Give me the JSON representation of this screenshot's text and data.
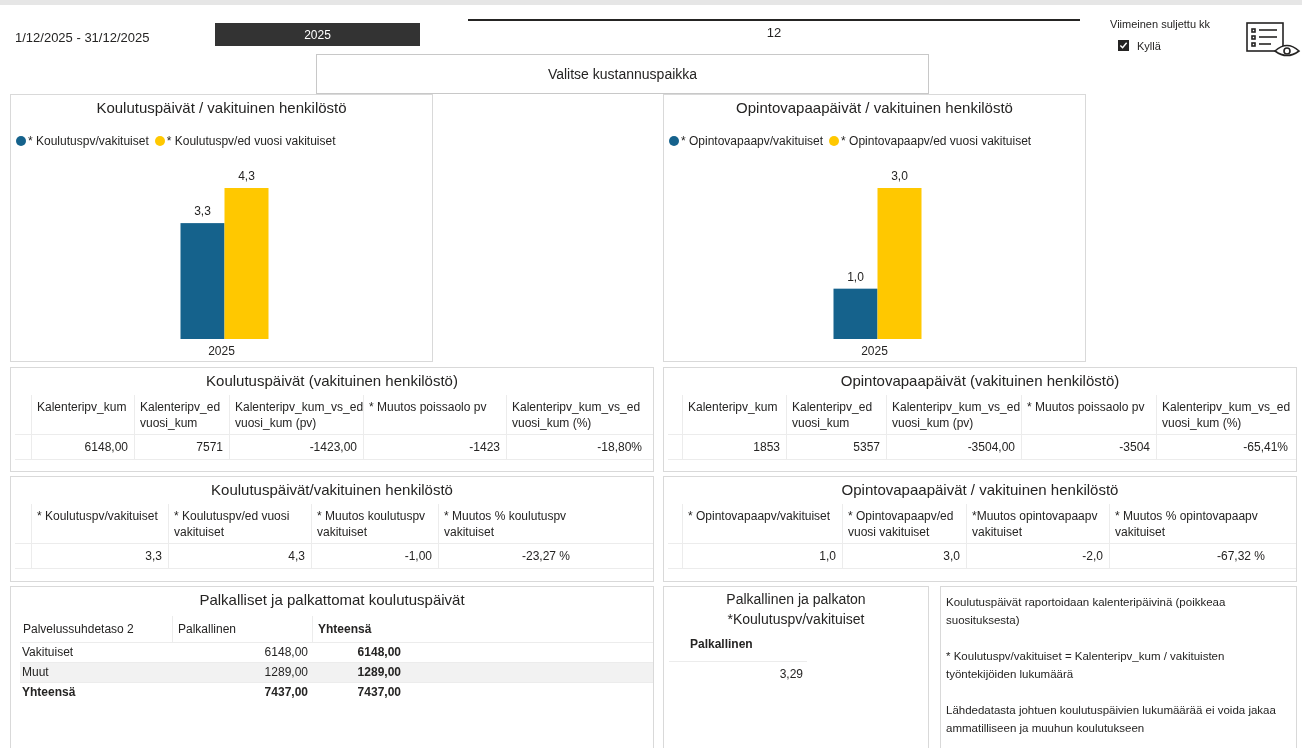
{
  "header": {
    "date_range": "1/12/2025 - 31/12/2025",
    "year_slicer": {
      "value": "2025"
    },
    "month_slicer": {
      "value": "12"
    },
    "closed_month_filter": {
      "title": "Viimeinen suljettu kk",
      "options": [
        {
          "label": "Kyllä",
          "checked": true
        }
      ]
    },
    "cost_center_button": {
      "label": "Valitse kustannuspaikka"
    }
  },
  "charts": [
    {
      "title": "Koulutuspäivät / vakituinen henkilöstö",
      "chart_data": {
        "type": "bar",
        "categories": [
          "2025"
        ],
        "series": [
          {
            "name": "* Koulutuspv/vakituiset",
            "color": "#15628c",
            "values": [
              3.3
            ],
            "value_labels": [
              "3,3"
            ]
          },
          {
            "name": "* Koulutuspv/ed vuosi vakituiset",
            "color": "#ffc800",
            "values": [
              4.3
            ],
            "value_labels": [
              "4,3"
            ]
          }
        ],
        "data_labels": true
      }
    },
    {
      "title": "Opintovapaapäivät / vakituinen henkilöstö",
      "chart_data": {
        "type": "bar",
        "categories": [
          "2025"
        ],
        "series": [
          {
            "name": "* Opintovapaapv/vakituiset",
            "color": "#15628c",
            "values": [
              1.0
            ],
            "value_labels": [
              "1,0"
            ]
          },
          {
            "name": "* Opintovapaapv/ed vuosi vakituiset",
            "color": "#ffc800",
            "values": [
              3.0
            ],
            "value_labels": [
              "3,0"
            ]
          }
        ],
        "data_labels": true
      }
    }
  ],
  "tables": [
    {
      "title": "Koulutuspäivät (vakituinen henkilöstö)",
      "columns": [
        "Kalenteripv_kum",
        "Kalenteripv_ed vuosi_kum",
        "Kalenteripv_kum_vs_ed vuosi_kum (pv)",
        "* Muutos poissaolo pv",
        "Kalenteripv_kum_vs_ed vuosi_kum (%)"
      ],
      "rows": [
        [
          "6148,00",
          "7571",
          "-1423,00",
          "-1423",
          "-18,80%"
        ]
      ]
    },
    {
      "title": "Opintovapaapäivät (vakituinen henkilöstö)",
      "columns": [
        "Kalenteripv_kum",
        "Kalenteripv_ed vuosi_kum",
        "Kalenteripv_kum_vs_ed vuosi_kum (pv)",
        "* Muutos poissaolo pv",
        "Kalenteripv_kum_vs_ed vuosi_kum (%)"
      ],
      "rows": [
        [
          "1853",
          "5357",
          "-3504,00",
          "-3504",
          "-65,41%"
        ]
      ]
    },
    {
      "title": "Koulutuspäivät/vakituinen henkilöstö",
      "columns": [
        "* Koulutuspv/vakituiset",
        "* Koulutuspv/ed vuosi vakituiset",
        "* Muutos koulutuspv vakituiset",
        "* Muutos % koulutuspv vakituiset"
      ],
      "rows": [
        [
          "3,3",
          "4,3",
          "-1,00",
          "-23,27 %"
        ]
      ]
    },
    {
      "title": "Opintovapaapäivät / vakituinen henkilöstö",
      "columns": [
        "* Opintovapaapv/vakituiset",
        "* Opintovapaapv/ed vuosi vakituiset",
        "*Muutos opintovapaapv vakituiset",
        "* Muutos % opintovapaapv vakituiset"
      ],
      "rows": [
        [
          "1,0",
          "3,0",
          "-2,0",
          "-67,32 %"
        ]
      ]
    }
  ],
  "matrix": {
    "title": "Palkalliset ja palkattomat koulutuspäivät",
    "columns": [
      "Palvelussuhdetaso 2",
      "Palkallinen",
      "Yhteensä"
    ],
    "rows": [
      {
        "kind": "data",
        "cells": [
          "Vakituiset",
          "6148,00",
          "6148,00"
        ]
      },
      {
        "kind": "data",
        "cells": [
          "Muut",
          "1289,00",
          "1289,00"
        ]
      },
      {
        "kind": "total",
        "cells": [
          "Yhteensä",
          "7437,00",
          "7437,00"
        ]
      }
    ]
  },
  "paid_card": {
    "title_lines": [
      "Palkallinen ja palkaton",
      "*Koulutuspv/vakituiset"
    ],
    "column": "Palkallinen",
    "value": "3,29"
  },
  "notes": {
    "paragraphs": [
      "Koulutuspäivät raportoidaan kalenteripäivinä (poikkeaa suosituksesta)",
      "* Koulutuspv/vakituiset = Kalenteripv_kum / vakituisten työntekijöiden lukumäärä",
      "Lähdedatasta johtuen koulutuspäivien lukumäärää ei voida jakaa ammatilliseen ja muuhun koulutukseen"
    ]
  }
}
